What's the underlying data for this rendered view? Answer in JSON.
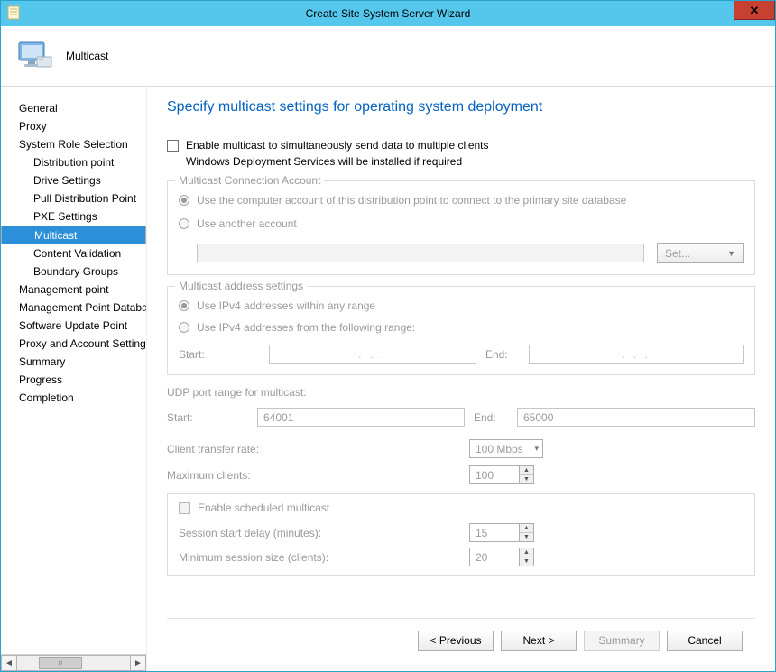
{
  "titlebar": {
    "title": "Create Site System Server Wizard"
  },
  "header": {
    "label": "Multicast"
  },
  "sidebar": [
    {
      "label": "General",
      "sub": false,
      "sel": false
    },
    {
      "label": "Proxy",
      "sub": false,
      "sel": false
    },
    {
      "label": "System Role Selection",
      "sub": false,
      "sel": false
    },
    {
      "label": "Distribution point",
      "sub": true,
      "sel": false
    },
    {
      "label": "Drive Settings",
      "sub": true,
      "sel": false
    },
    {
      "label": "Pull Distribution Point",
      "sub": true,
      "sel": false
    },
    {
      "label": "PXE Settings",
      "sub": true,
      "sel": false
    },
    {
      "label": "Multicast",
      "sub": true,
      "sel": true
    },
    {
      "label": "Content Validation",
      "sub": true,
      "sel": false
    },
    {
      "label": "Boundary Groups",
      "sub": true,
      "sel": false
    },
    {
      "label": "Management point",
      "sub": false,
      "sel": false
    },
    {
      "label": "Management Point Database",
      "sub": false,
      "sel": false
    },
    {
      "label": "Software Update Point",
      "sub": false,
      "sel": false
    },
    {
      "label": "Proxy and Account Settings",
      "sub": false,
      "sel": false
    },
    {
      "label": "Summary",
      "sub": false,
      "sel": false
    },
    {
      "label": "Progress",
      "sub": false,
      "sel": false
    },
    {
      "label": "Completion",
      "sub": false,
      "sel": false
    }
  ],
  "page": {
    "title": "Specify multicast settings for operating system deployment",
    "enable_label": "Enable multicast to simultaneously send data to multiple clients",
    "enable_note": "Windows Deployment Services will be installed if required",
    "grp_conn": {
      "legend": "Multicast Connection Account",
      "opt1": "Use the computer account of this distribution point to connect to the primary site database",
      "opt2": "Use another account",
      "set_btn": "Set..."
    },
    "grp_addr": {
      "legend": "Multicast address settings",
      "opt1": "Use IPv4 addresses within any range",
      "opt2": "Use IPv4 addresses from the following range:",
      "start": "Start:",
      "end": "End:",
      "ip_placeholder": ".       .       ."
    },
    "udp": {
      "label": "UDP port range for multicast:",
      "start": "Start:",
      "start_val": "64001",
      "end": "End:",
      "end_val": "65000"
    },
    "rate": {
      "label": "Client transfer rate:",
      "value": "100 Mbps"
    },
    "max": {
      "label": "Maximum clients:",
      "value": "100"
    },
    "sched": {
      "chk": "Enable scheduled multicast",
      "delay_label": "Session start delay (minutes):",
      "delay_val": "15",
      "min_label": "Minimum session size (clients):",
      "min_val": "20"
    }
  },
  "buttons": {
    "prev": "< Previous",
    "next": "Next >",
    "summary": "Summary",
    "cancel": "Cancel"
  }
}
